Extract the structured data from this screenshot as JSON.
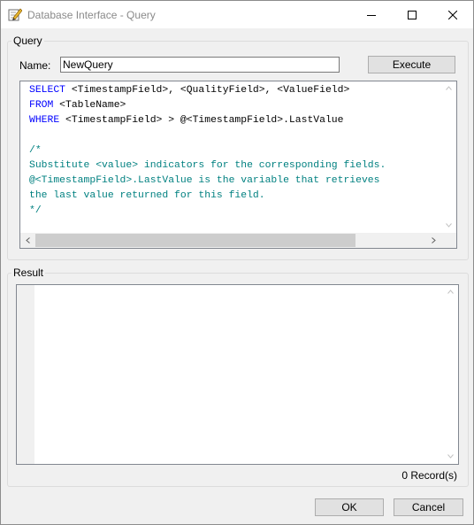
{
  "window": {
    "title": "Database Interface - Query",
    "icon": "edit-pencil-icon"
  },
  "query": {
    "legend": "Query",
    "name_label": "Name:",
    "name_value": "NewQuery",
    "execute_label": "Execute",
    "code_lines": [
      [
        {
          "t": "SELECT",
          "c": "kw"
        },
        {
          "t": " <TimestampField>, <QualityField>, <ValueField>",
          "c": "txt"
        }
      ],
      [
        {
          "t": "FROM",
          "c": "kw"
        },
        {
          "t": " <TableName>",
          "c": "txt"
        }
      ],
      [
        {
          "t": "WHERE",
          "c": "kw"
        },
        {
          "t": " <TimestampField> > @<TimestampField>.LastValue",
          "c": "txt"
        }
      ],
      [],
      [
        {
          "t": "/*",
          "c": "cm"
        }
      ],
      [
        {
          "t": "Substitute <value> indicators for the corresponding fields.",
          "c": "cm"
        }
      ],
      [
        {
          "t": "@<TimestampField>.LastValue is the variable that retrieves",
          "c": "cm"
        }
      ],
      [
        {
          "t": "the last value returned for this field.",
          "c": "cm"
        }
      ],
      [
        {
          "t": "*/",
          "c": "cm"
        }
      ]
    ]
  },
  "result": {
    "legend": "Result",
    "records": "0 Record(s)"
  },
  "footer": {
    "ok_label": "OK",
    "cancel_label": "Cancel"
  }
}
